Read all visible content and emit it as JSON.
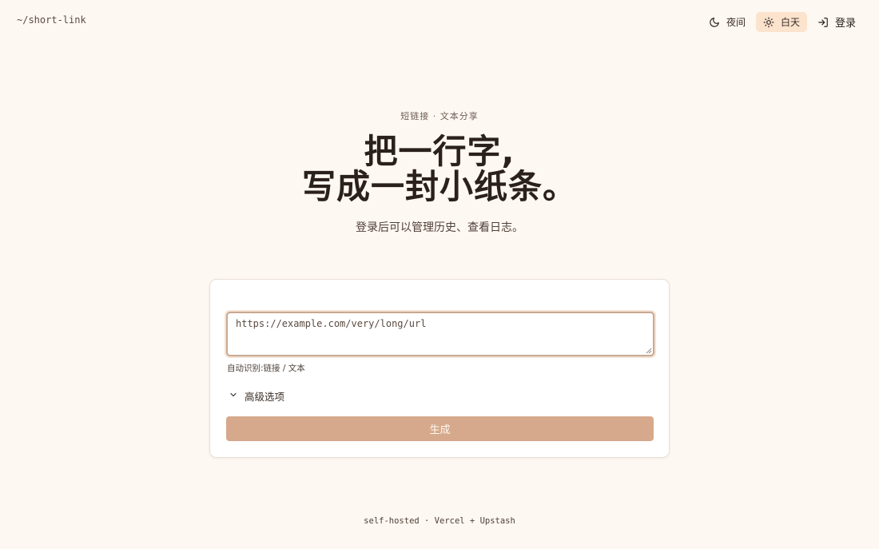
{
  "header": {
    "brand": "~/short-link",
    "theme_night_label": "夜间",
    "theme_day_label": "白天",
    "login_label": "登录"
  },
  "hero": {
    "eyebrow": "短链接 · 文本分享",
    "title_line1": "把一行字,",
    "title_line2": "写成一封小纸条。",
    "subtitle": "登录后可以管理历史、查看日志。"
  },
  "form": {
    "input_placeholder": "https://example.com/very/long/url",
    "hint": "自动识别:链接 / 文本",
    "advanced_label": "高级选项",
    "generate_label": "生成"
  },
  "footer": {
    "text": "self-hosted · Vercel + Upstash"
  },
  "colors": {
    "background": "#fef8f2",
    "accent": "#d6a98c",
    "active_toggle": "#fbe3cd",
    "text": "#2b211c"
  }
}
